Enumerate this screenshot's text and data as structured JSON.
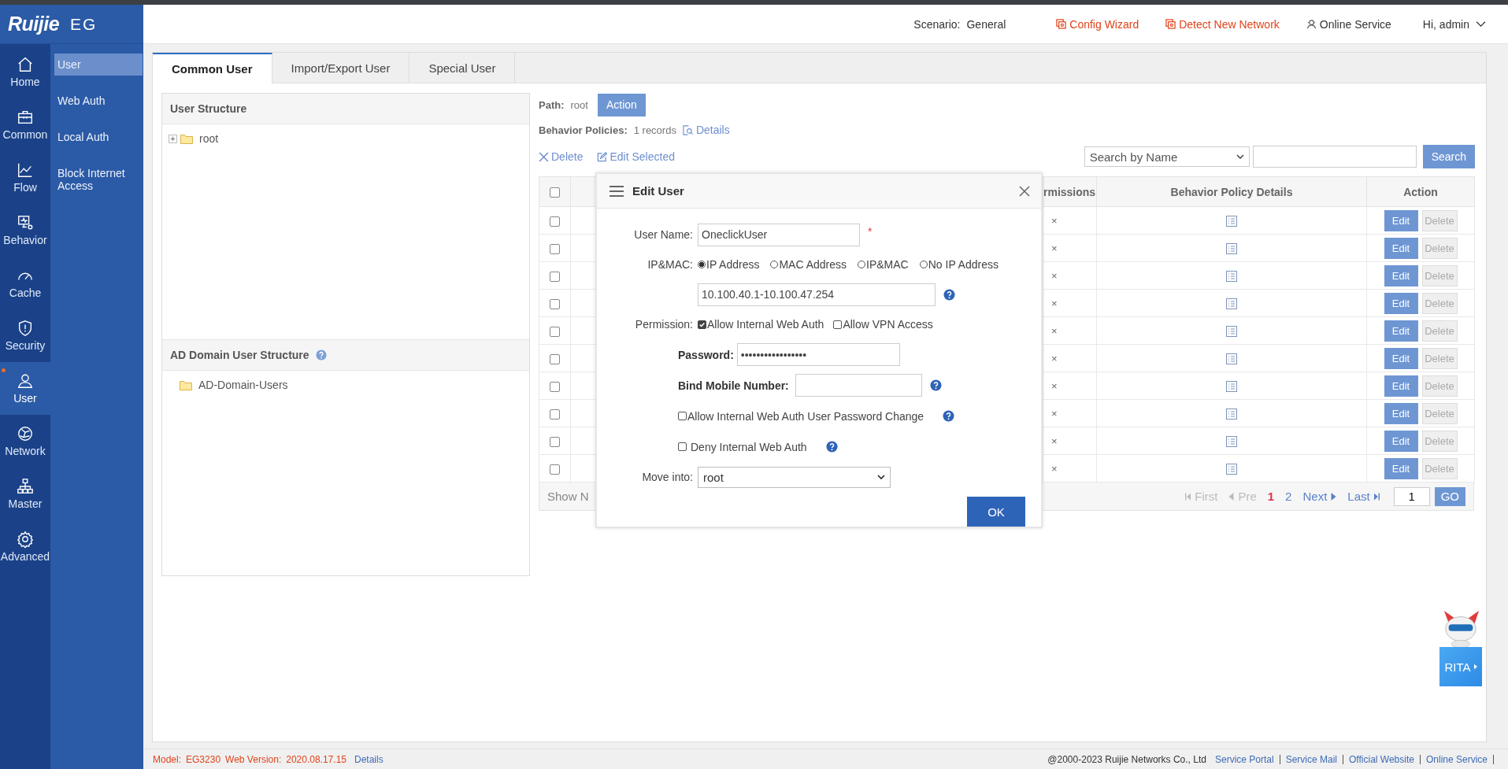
{
  "brand": {
    "logo": "Ruijie",
    "product": "EG"
  },
  "nav": [
    {
      "label": "Home",
      "selected": false
    },
    {
      "label": "Common",
      "selected": false
    },
    {
      "label": "Flow",
      "selected": false
    },
    {
      "label": "Behavior",
      "selected": false
    },
    {
      "label": "Cache",
      "selected": false
    },
    {
      "label": "Security",
      "selected": false
    },
    {
      "label": "User",
      "selected": true
    },
    {
      "label": "Network",
      "selected": false
    },
    {
      "label": "Master",
      "selected": false
    },
    {
      "label": "Advanced",
      "selected": false
    }
  ],
  "submenu": [
    {
      "label": "User",
      "selected": true
    },
    {
      "label": "Web Auth",
      "selected": false
    },
    {
      "label": "Local Auth",
      "selected": false
    },
    {
      "label": "Block Internet Access",
      "selected": false
    }
  ],
  "topbar": {
    "scenario_label": "Scenario:",
    "scenario": "General",
    "config_wizard": "Config Wizard",
    "detect": "Detect New Network",
    "online_service": "Online Service",
    "user": "Hi, admin"
  },
  "tabs": [
    {
      "label": "Common User",
      "selected": true
    },
    {
      "label": "Import/Export User",
      "selected": false
    },
    {
      "label": "Special User",
      "selected": false
    }
  ],
  "user_structure": {
    "title": "User Structure",
    "tree": [
      {
        "label": "root",
        "expander": "+"
      }
    ]
  },
  "ad_structure": {
    "title": "AD Domain User Structure",
    "tree": [
      {
        "label": "AD-Domain-Users"
      }
    ]
  },
  "path": {
    "label": "Path:",
    "value": "root",
    "action": "Action"
  },
  "behavior_policies": {
    "label": "Behavior Policies:",
    "value": "1 records",
    "details": "Details"
  },
  "toolbar": {
    "delete": "Delete",
    "edit_selected": "Edit Selected",
    "search_by": "Search by Name",
    "search": "Search"
  },
  "table": {
    "columns": [
      "",
      "",
      "rmissions",
      "Behavior Policy Details",
      "Action"
    ],
    "header_checked": false,
    "rows": [
      {
        "checked": false,
        "permissions": "×",
        "edit": "Edit",
        "delete": "Delete",
        "delete_disabled": true
      },
      {
        "checked": false,
        "permissions": "×",
        "edit": "Edit",
        "delete": "Delete",
        "delete_disabled": true
      },
      {
        "checked": false,
        "permissions": "×",
        "edit": "Edit",
        "delete": "Delete",
        "delete_disabled": true
      },
      {
        "checked": false,
        "permissions": "×",
        "edit": "Edit",
        "delete": "Delete",
        "delete_disabled": true
      },
      {
        "checked": false,
        "permissions": "×",
        "edit": "Edit",
        "delete": "Delete",
        "delete_disabled": true
      },
      {
        "checked": false,
        "permissions": "×",
        "edit": "Edit",
        "delete": "Delete",
        "delete_disabled": true
      },
      {
        "checked": false,
        "permissions": "×",
        "edit": "Edit",
        "delete": "Delete",
        "delete_disabled": true
      },
      {
        "checked": false,
        "permissions": "×",
        "edit": "Edit",
        "delete": "Delete",
        "delete_disabled": true
      },
      {
        "checked": false,
        "permissions": "×",
        "edit": "Edit",
        "delete": "Delete",
        "delete_disabled": true
      },
      {
        "checked": false,
        "permissions": "×",
        "edit": "Edit",
        "delete": "Delete",
        "delete_disabled": true
      }
    ],
    "show_text": "Show N",
    "pager": [
      {
        "kind": "first",
        "label": "First",
        "disabled": true
      },
      {
        "kind": "prev",
        "label": "Pre",
        "disabled": true
      },
      {
        "kind": "page",
        "label": "1",
        "selected": true
      },
      {
        "kind": "page",
        "label": "2",
        "selected": false
      },
      {
        "kind": "next",
        "label": "Next",
        "disabled": false
      },
      {
        "kind": "last",
        "label": "Last",
        "disabled": false
      }
    ],
    "page_input": "1",
    "go": "GO"
  },
  "dialog": {
    "title": "Edit User",
    "user_name": {
      "label": "User Name:",
      "value": "OneclickUser",
      "required": "*"
    },
    "ipmac": {
      "label": "IP&MAC:",
      "options": [
        {
          "label": "IP Address",
          "selected": true
        },
        {
          "label": "MAC Address",
          "selected": false
        },
        {
          "label": "IP&MAC",
          "selected": false
        },
        {
          "label": "No IP Address",
          "selected": false
        }
      ],
      "value": "10.100.40.1-10.100.47.254"
    },
    "permission": {
      "label": "Permission:",
      "options": [
        {
          "label": "Allow Internal Web Auth",
          "checked": true
        },
        {
          "label": "Allow VPN Access",
          "checked": false
        }
      ]
    },
    "password": {
      "label": "Password:",
      "value": "•••••••••••••••••"
    },
    "mobile": {
      "label": "Bind Mobile Number:"
    },
    "allow_change": {
      "label": "Allow Internal Web Auth User Password Change",
      "checked": false
    },
    "deny": {
      "label": "Deny Internal Web Auth",
      "checked": false
    },
    "move_into": {
      "label": "Move into:",
      "value": "root"
    },
    "ok": "OK"
  },
  "assistant": {
    "label": "RITA"
  },
  "footer": {
    "model_label": "Model:",
    "model": "EG3230",
    "version_label": "Web Version:",
    "version": "2020.08.17.15",
    "details": "Details",
    "copyright": "@2000-2023 Ruijie Networks Co., Ltd",
    "links": [
      "Service Portal",
      "Service Mail",
      "Official Website",
      "Online Service"
    ]
  }
}
